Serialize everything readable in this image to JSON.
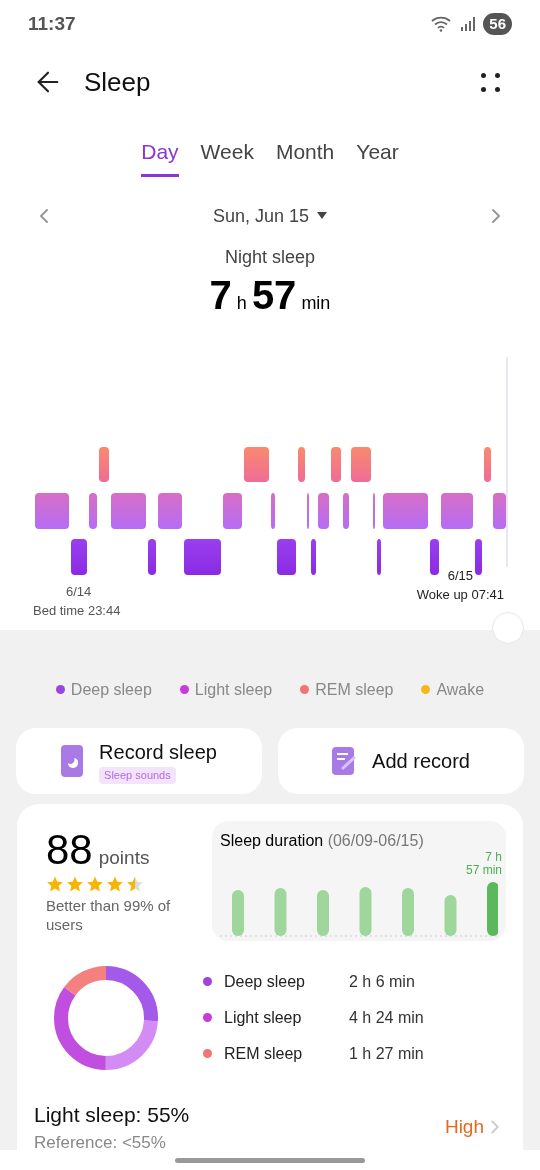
{
  "status_bar": {
    "time": "11:37",
    "battery": "56"
  },
  "header": {
    "title": "Sleep"
  },
  "tabs": [
    {
      "label": "Day",
      "selected": true
    },
    {
      "label": "Week",
      "selected": false
    },
    {
      "label": "Month",
      "selected": false
    },
    {
      "label": "Year",
      "selected": false
    }
  ],
  "date": "Sun, Jun 15",
  "summary": {
    "label": "Night sleep",
    "hours": "7",
    "hours_unit": "h",
    "minutes": "57",
    "minutes_unit": "min"
  },
  "timeline": {
    "start_date": "6/14",
    "start_label": "Bed time 23:44",
    "end_date": "6/15",
    "end_label": "Woke up 07:41"
  },
  "legend": [
    {
      "label": "Deep sleep",
      "color": "#9a45e2"
    },
    {
      "label": "Light sleep",
      "color": "#c93ad8"
    },
    {
      "label": "REM sleep",
      "color": "#f27474"
    },
    {
      "label": "Awake",
      "color": "#f5b61f"
    }
  ],
  "actions": [
    {
      "kind": "record",
      "label": "Record sleep",
      "tag": "Sleep sounds"
    },
    {
      "kind": "add",
      "label": "Add record"
    }
  ],
  "score": {
    "value": "88",
    "unit": "points",
    "stars": 4.5,
    "note": "Better than 99% of users"
  },
  "duration_chart": {
    "title": "Sleep duration",
    "range": "(06/09-06/15)",
    "latest": "7 h\n57 min"
  },
  "stages": [
    {
      "label": "Deep sleep",
      "value": "2 h 6 min",
      "color": "#9a45e2"
    },
    {
      "label": "Light sleep",
      "value": "4 h 24 min",
      "color": "#c93ad8"
    },
    {
      "label": "REM sleep",
      "value": "1 h 27 min",
      "color": "#f27474"
    }
  ],
  "insight": {
    "title": "Light sleep: 55%",
    "reference": "Reference: <55%",
    "rating": "High"
  }
}
